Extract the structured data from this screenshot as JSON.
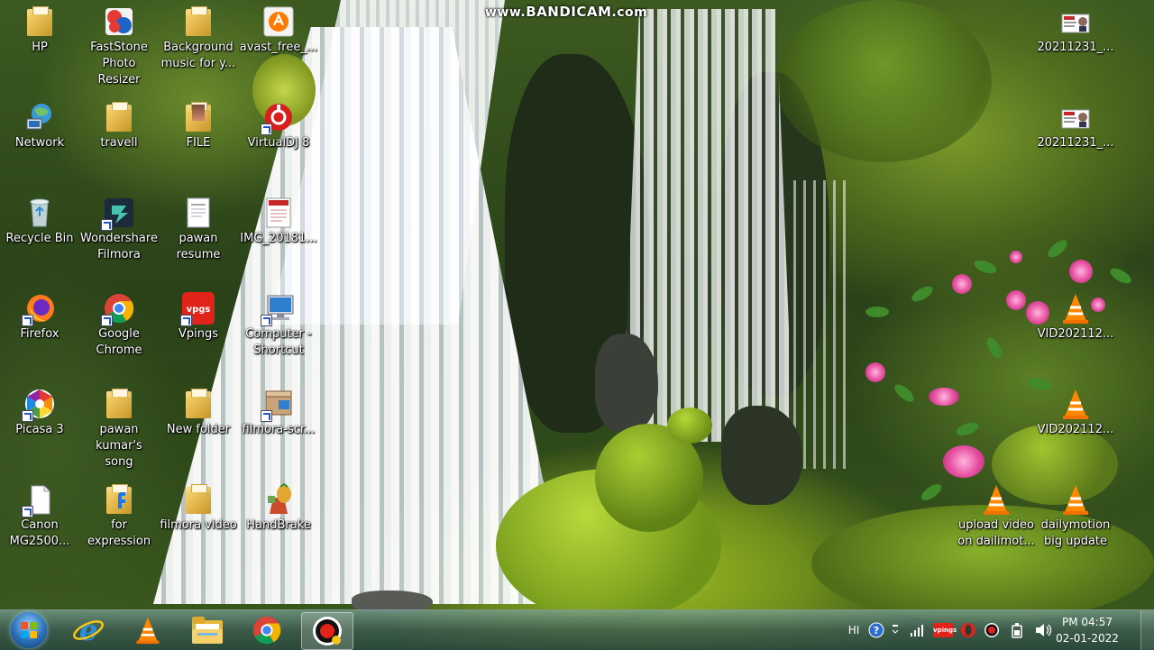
{
  "watermark": {
    "prefix": "www.",
    "brand": "BANDICAM",
    "suffix": ".com"
  },
  "desktop_icons": {
    "hp": "HP",
    "faststone": "FastStone\nPhoto Resizer",
    "background_music": "Background\nmusic for y...",
    "avast": "avast_free_...",
    "network": "Network",
    "travell": "travell",
    "file": "FILE",
    "virtualdj": "VirtualDJ 8",
    "recycle_bin": "Recycle Bin",
    "wondershare": "Wondershare\nFilmora",
    "pawan_resume": "pawan\nresume",
    "img_2018": "IMG_20181...",
    "firefox": "Firefox",
    "google_chrome": "Google\nChrome",
    "vpings": "Vpings",
    "computer_shortcut": "Computer -\nShortcut",
    "picasa": "Picasa 3",
    "pawan_song": "pawan\nkumar's song",
    "new_folder": "New folder",
    "filmora_scr": "filmora-scr...",
    "canon": "Canon\nMG2500...",
    "for_expression": "for\nexpression",
    "filmora_video": "filmora video",
    "handbrake": "HandBrake",
    "file_20211231_a": "20211231_...",
    "file_20211231_b": "20211231_...",
    "vid_a": "VID202112...",
    "vid_b": "VID202112...",
    "upload_video": "upload video\non dailimot...",
    "dailymotion": "dailymotion\nbig update"
  },
  "taskbar": {
    "pinned": [
      "start-orb",
      "internet-explorer-icon",
      "vlc-icon",
      "file-explorer-icon",
      "chrome-icon",
      "bandicam-icon"
    ],
    "active_item": "bandicam-icon"
  },
  "tray": {
    "language": "HI",
    "vpings_badge": "vpings",
    "time": "PM 04:57",
    "date": "02-01-2022"
  },
  "colors": {
    "accent_red": "#e2231a",
    "chrome_green": "#34a853",
    "vlc_orange": "#ff8800"
  }
}
